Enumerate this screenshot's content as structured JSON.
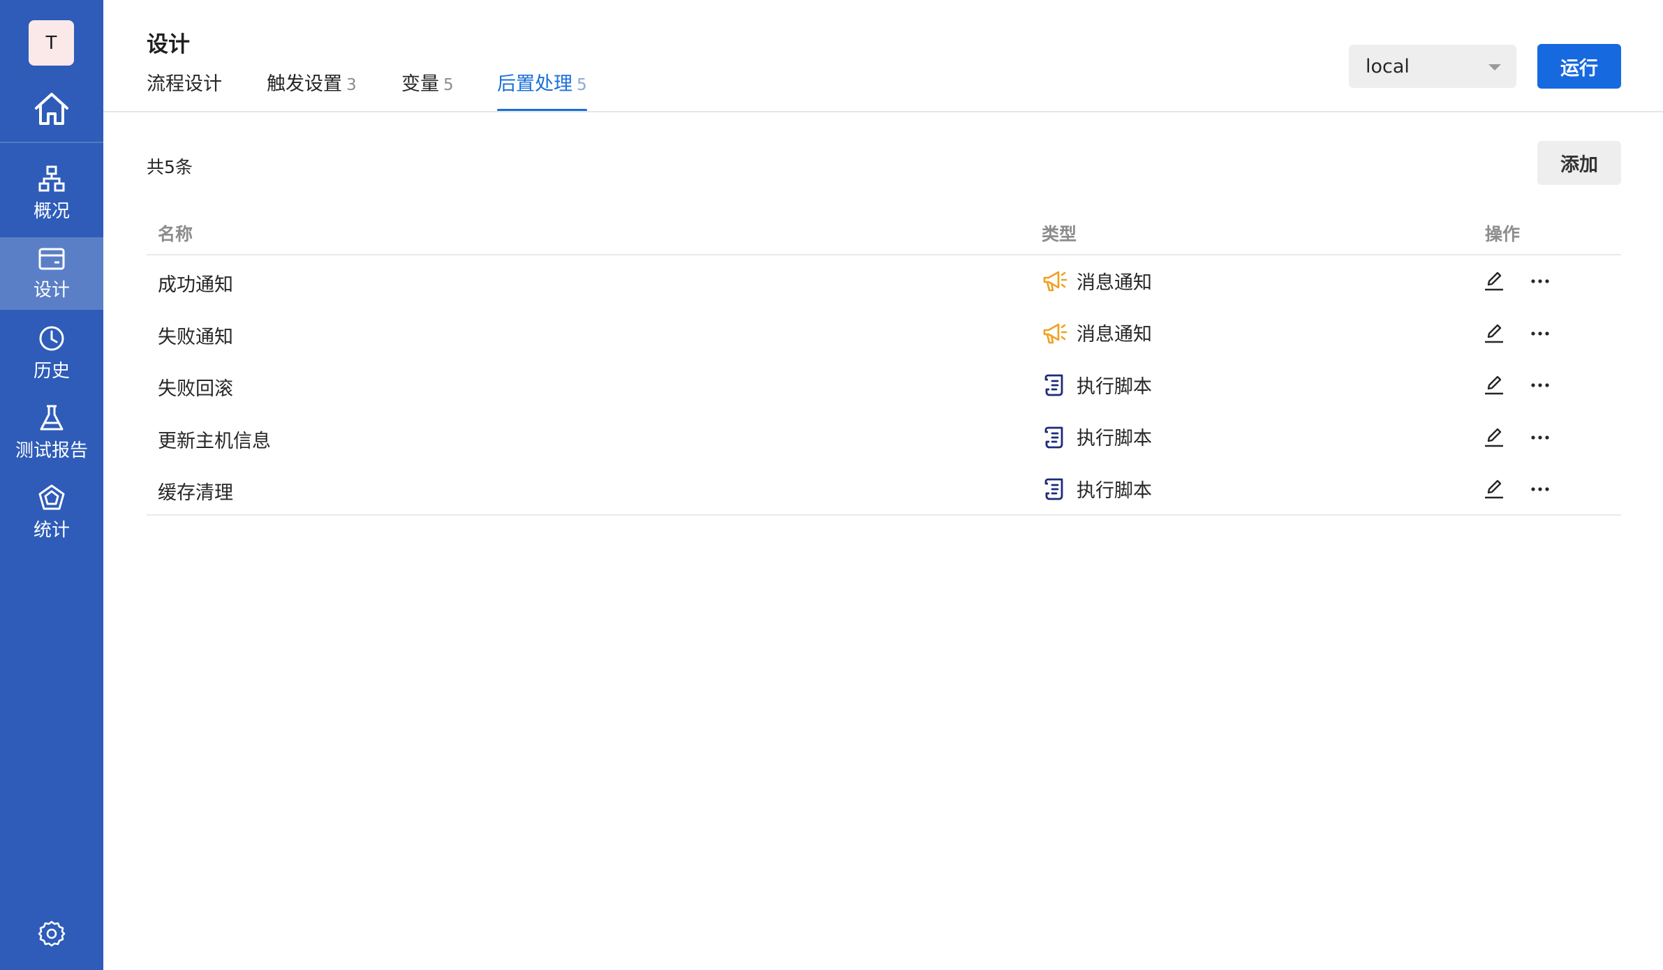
{
  "sidebar": {
    "avatar_letter": "T",
    "items": [
      {
        "label": "概况",
        "icon": "org-chart-icon"
      },
      {
        "label": "设计",
        "icon": "card-icon",
        "active": true
      },
      {
        "label": "历史",
        "icon": "clock-icon"
      },
      {
        "label": "测试报告",
        "icon": "flask-icon"
      },
      {
        "label": "统计",
        "icon": "radar-icon"
      }
    ]
  },
  "header": {
    "title": "设计",
    "tabs": [
      {
        "label": "流程设计",
        "count": ""
      },
      {
        "label": "触发设置",
        "count": "3"
      },
      {
        "label": "变量",
        "count": "5"
      },
      {
        "label": "后置处理",
        "count": "5",
        "active": true
      }
    ],
    "environment": "local",
    "run_label": "运行"
  },
  "content": {
    "total_text": "共5条",
    "add_label": "添加",
    "columns": {
      "name": "名称",
      "type": "类型",
      "actions": "操作"
    },
    "rows": [
      {
        "name": "成功通知",
        "type": "消息通知",
        "type_icon": "megaphone-icon"
      },
      {
        "name": "失败通知",
        "type": "消息通知",
        "type_icon": "megaphone-icon"
      },
      {
        "name": "失败回滚",
        "type": "执行脚本",
        "type_icon": "script-scroll-icon"
      },
      {
        "name": "更新主机信息",
        "type": "执行脚本",
        "type_icon": "script-scroll-icon"
      },
      {
        "name": "缓存清理",
        "type": "执行脚本",
        "type_icon": "script-scroll-icon"
      }
    ]
  },
  "colors": {
    "sidebar_bg": "#2e5cb8",
    "primary": "#1769e0",
    "tab_active": "#1a6fd9",
    "notify_icon": "#f0a020",
    "script_icon": "#1c2a7a"
  }
}
